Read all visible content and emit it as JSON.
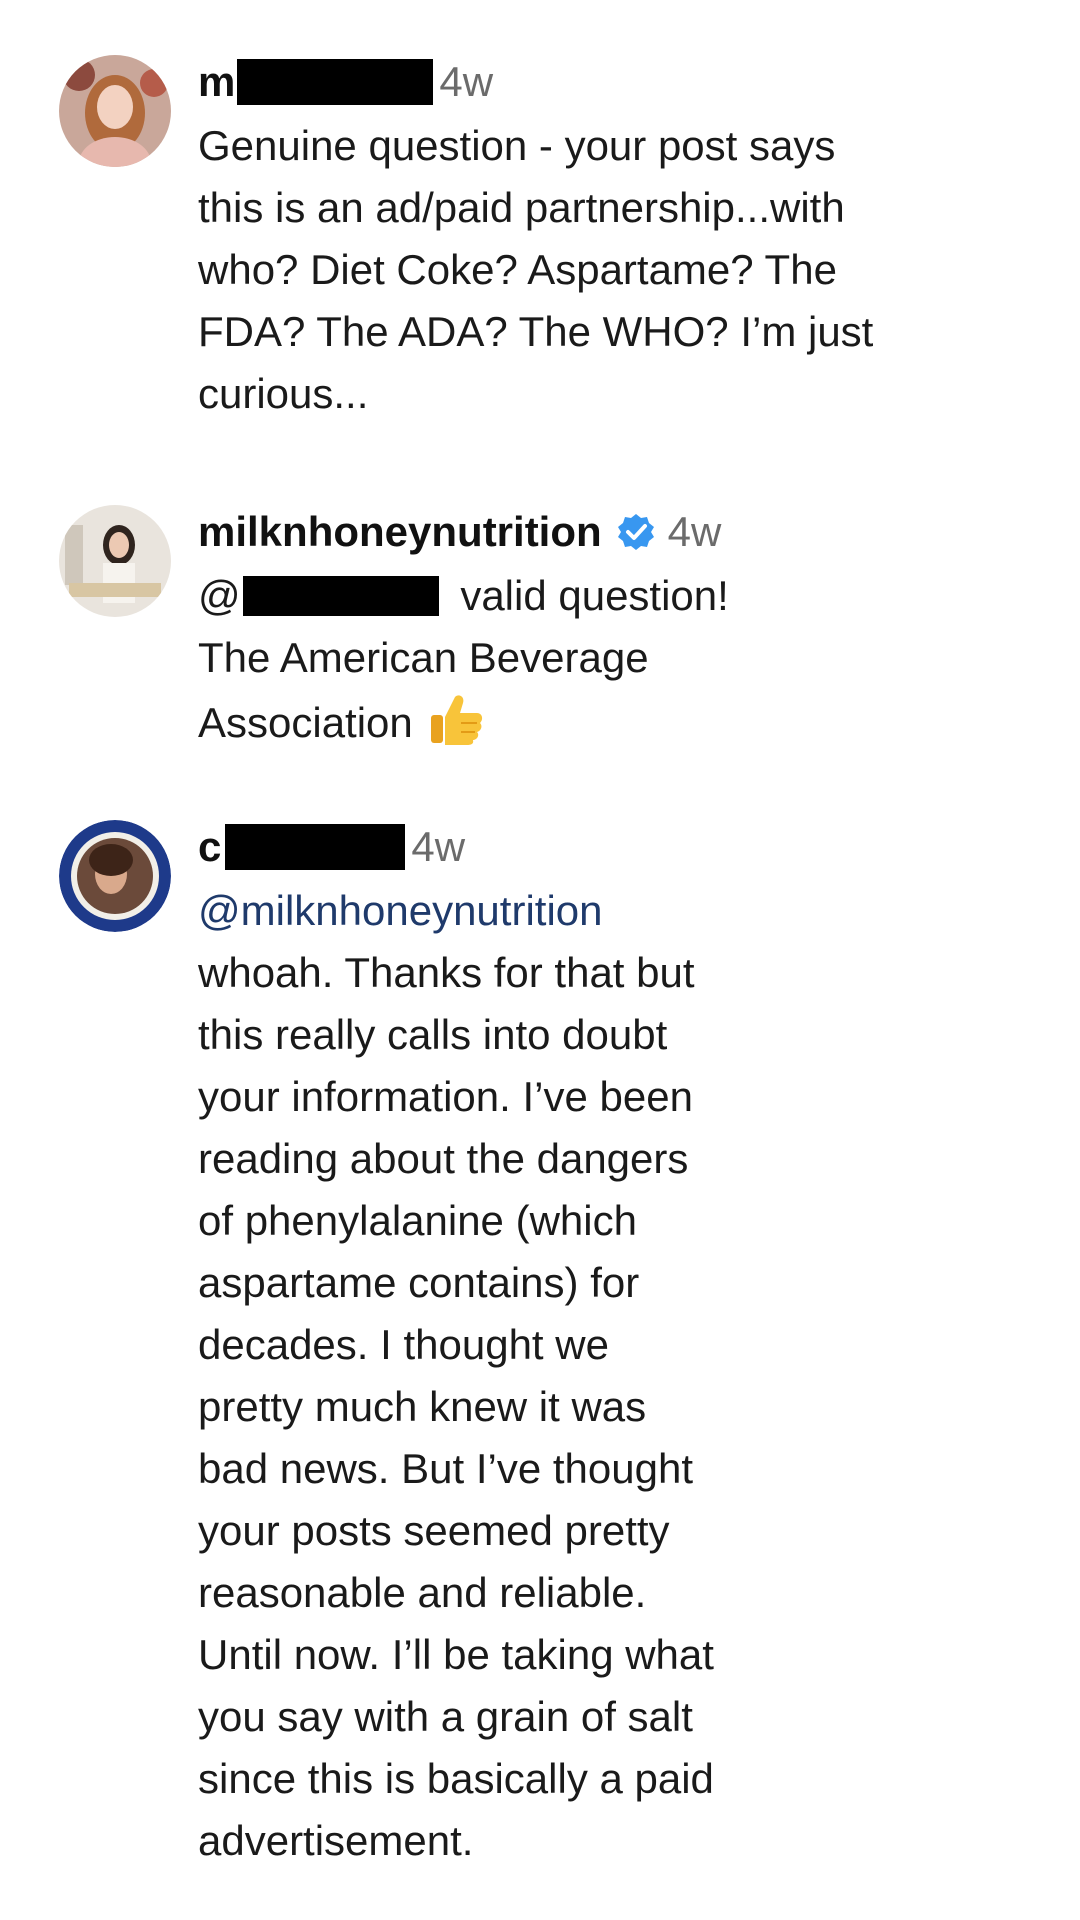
{
  "comments": [
    {
      "username_prefix": "m",
      "time": "4w",
      "lines": [
        "Genuine question - your post says",
        "this is an ad/paid partnership...with",
        "who? Diet Coke? Aspartame? The",
        "FDA? The ADA? The WHO? I’m just",
        "curious..."
      ]
    },
    {
      "username": "milknhoneynutrition",
      "time": "4w",
      "mention_prefix": "@",
      "reply_suffix": "valid question!",
      "lines": [
        "The American Beverage",
        "Association"
      ],
      "emoji": "thumbs-up"
    },
    {
      "username_prefix": "c",
      "time": "4w",
      "mention": "@milknhoneynutrition",
      "lines": [
        "whoah. Thanks for that but",
        "this really calls into doubt",
        "your information. I’ve been",
        "reading about the dangers",
        "of phenylalanine (which",
        "aspartame contains) for",
        "decades. I thought we",
        "pretty much knew it was",
        "bad news. But I’ve thought",
        "your posts seemed pretty",
        "reasonable and reliable.",
        "Until now. I’ll be taking what",
        "you say with a grain of salt",
        "since this is basically a paid",
        "advertisement."
      ]
    }
  ],
  "colors": {
    "verified_badge": "#3897f0",
    "mention_link": "#1f3a6b",
    "timestamp": "#6b6b6b",
    "redaction": "#000000"
  }
}
